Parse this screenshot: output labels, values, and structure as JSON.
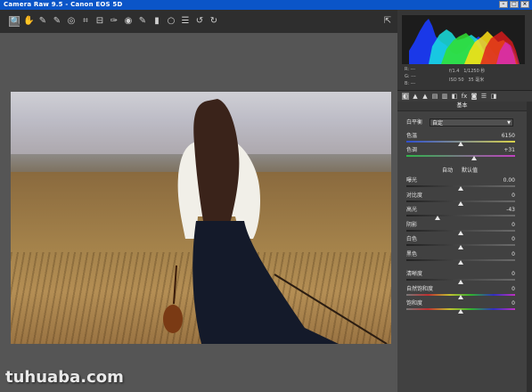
{
  "window": {
    "title": "Camera Raw 9.5 - Canon EOS 5D",
    "buttons": [
      "–",
      "□",
      "×"
    ]
  },
  "toolbar": {
    "tools": [
      {
        "icon": "zoom-icon",
        "glyph": "🔍"
      },
      {
        "icon": "hand-icon",
        "glyph": "✋"
      },
      {
        "icon": "white-balance-icon",
        "glyph": "✎"
      },
      {
        "icon": "color-sampler-icon",
        "glyph": "✎"
      },
      {
        "icon": "targeted-adjust-icon",
        "glyph": "◎"
      },
      {
        "icon": "crop-icon",
        "glyph": "⌗"
      },
      {
        "icon": "straighten-icon",
        "glyph": "⊟"
      },
      {
        "icon": "spot-removal-icon",
        "glyph": "✑"
      },
      {
        "icon": "red-eye-icon",
        "glyph": "◉"
      },
      {
        "icon": "adjustment-brush-icon",
        "glyph": "✎"
      },
      {
        "icon": "graduated-filter-icon",
        "glyph": "▮"
      },
      {
        "icon": "radial-filter-icon",
        "glyph": "○"
      },
      {
        "icon": "preferences-icon",
        "glyph": "☰"
      },
      {
        "icon": "rotate-left-icon",
        "glyph": "↺"
      },
      {
        "icon": "rotate-right-icon",
        "glyph": "↻"
      }
    ],
    "fullscreen_glyph": "⇱"
  },
  "info": {
    "r": "R:",
    "g": "G:",
    "b": "B:",
    "dashes": "---",
    "aperture": "f/1.4",
    "shutter": "1/1250 秒",
    "iso": "ISO 50",
    "focal": "35 毫米"
  },
  "tabs": [
    "◐",
    "▲",
    "▲",
    "▤",
    "▥",
    "◧",
    "fx",
    "◙",
    "☰",
    "◨"
  ],
  "panel": {
    "title": "基本",
    "white_balance_label": "白平衡",
    "white_balance_value": "自定",
    "temperature": {
      "label": "色温",
      "value": "6150",
      "level": 0.5
    },
    "tint": {
      "label": "色调",
      "value": "+31",
      "level": 0.62
    },
    "auto_link": "自动",
    "default_link": "默认值",
    "sliders": [
      {
        "label": "曝光",
        "value": "0.00",
        "level": 0.5
      },
      {
        "label": "对比度",
        "value": "0",
        "level": 0.5
      },
      {
        "label": "高光",
        "value": "-43",
        "level": 0.29
      },
      {
        "label": "阴影",
        "value": "0",
        "level": 0.5
      },
      {
        "label": "白色",
        "value": "0",
        "level": 0.5
      },
      {
        "label": "黑色",
        "value": "0",
        "level": 0.5
      }
    ],
    "presence": [
      {
        "label": "清晰度",
        "value": "0",
        "level": 0.5
      },
      {
        "label": "自然饱和度",
        "value": "0",
        "level": 0.5
      },
      {
        "label": "饱和度",
        "value": "0",
        "level": 0.5
      }
    ]
  },
  "watermark": "tuhuaba.com",
  "colors": {
    "titlebar": "#0b55c8",
    "panel_bg": "#414141",
    "toolbar_bg": "#2e2e2e"
  }
}
